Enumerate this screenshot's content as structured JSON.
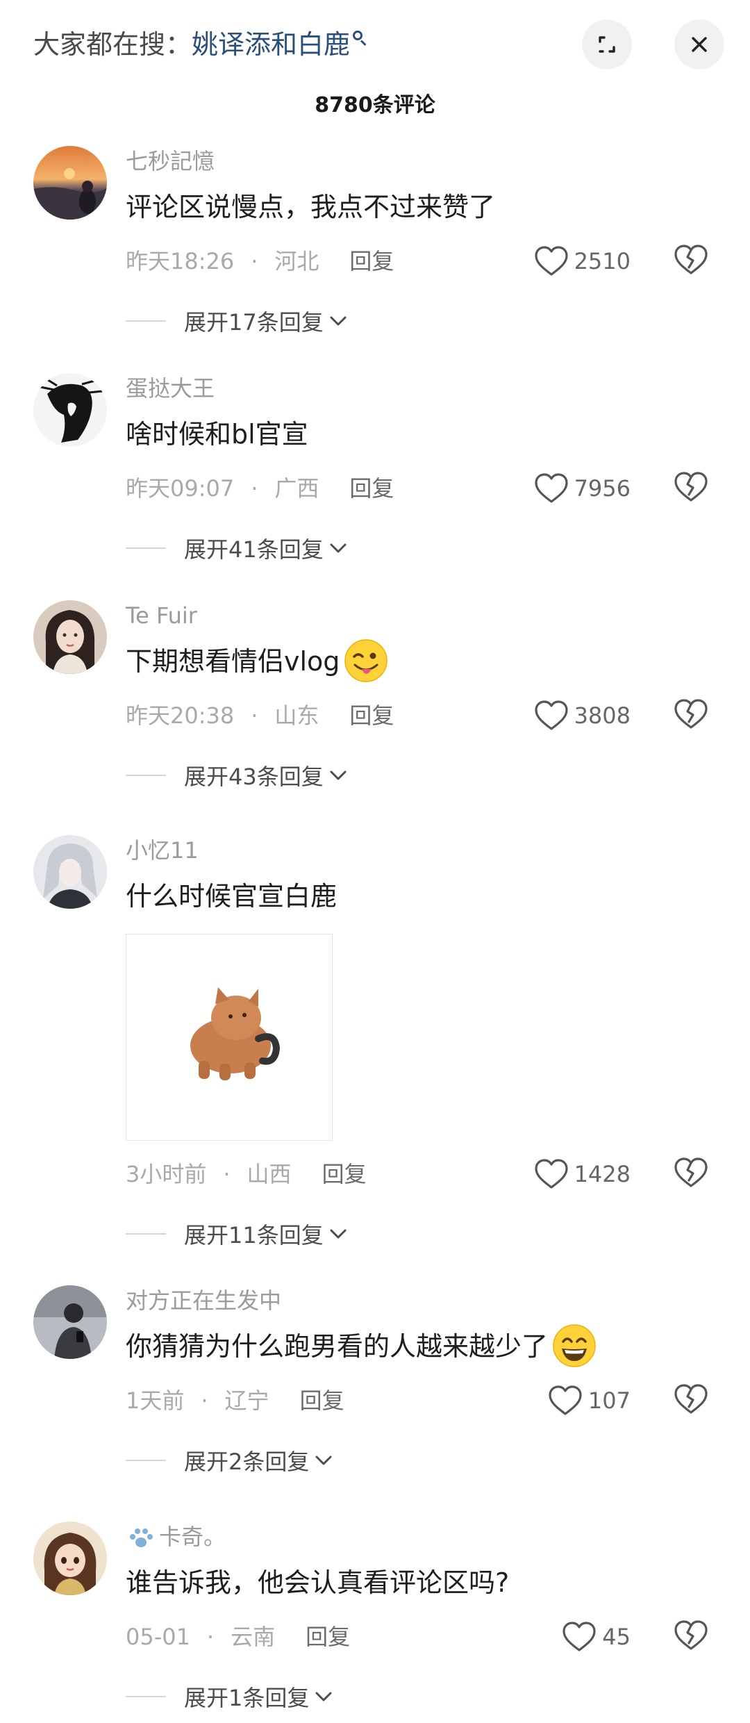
{
  "header": {
    "hot_search_prefix": "大家都在搜：",
    "hot_search_keyword": "姚译添和白鹿",
    "comment_count": "8780条评论"
  },
  "icons": {
    "search": "search-icon",
    "expand": "expand-icon",
    "close": "close-icon",
    "like": "heart-icon",
    "dislike": "broken-heart-icon",
    "chevron": "chevron-down-icon"
  },
  "colors": {
    "keyword": "#2a4f7a",
    "username": "#9b9b9b",
    "meta": "#a9a9a9",
    "text": "#1e1e1e"
  },
  "comments": [
    {
      "username": "七秒記憶",
      "text": "评论区说慢点，我点不过来赞了",
      "time": "昨天18:26",
      "location": "河北",
      "reply_label": "回复",
      "likes": "2510",
      "expand_label": "展开17条回复"
    },
    {
      "username": "蛋挞大王",
      "text": "啥时候和bl官宣",
      "time": "昨天09:07",
      "location": "广西",
      "reply_label": "回复",
      "likes": "7956",
      "expand_label": "展开41条回复"
    },
    {
      "username": "Te Fuir",
      "text": "下期想看情侣vlog",
      "time": "昨天20:38",
      "location": "山东",
      "reply_label": "回复",
      "likes": "3808",
      "expand_label": "展开43条回复"
    },
    {
      "username": "小忆11",
      "text": "什么时候官宣白鹿",
      "time": "3小时前",
      "location": "山西",
      "reply_label": "回复",
      "likes": "1428",
      "expand_label": "展开11条回复"
    },
    {
      "username": "对方正在生发中",
      "text": "你猜猜为什么跑男看的人越来越少了",
      "time": "1天前",
      "location": "辽宁",
      "reply_label": "回复",
      "likes": "107",
      "expand_label": "展开2条回复"
    },
    {
      "username": "卡奇。",
      "text": "谁告诉我，他会认真看评论区吗?",
      "time": "05-01",
      "location": "云南",
      "reply_label": "回复",
      "likes": "45",
      "expand_label": "展开1条回复"
    }
  ]
}
